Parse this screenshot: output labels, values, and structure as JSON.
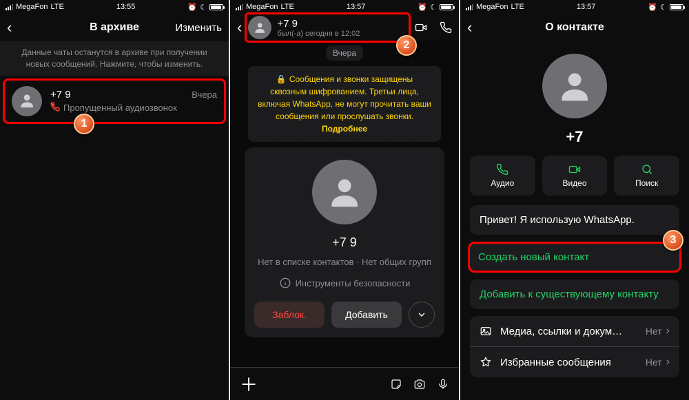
{
  "status": {
    "carrier": "MegaFon",
    "net": "LTE",
    "t1": "13:55",
    "t2": "13:57",
    "t3": "13:57"
  },
  "s1": {
    "title": "В архиве",
    "edit": "Изменить",
    "banner": "Данные чаты останутся в архиве при получении новых сообщений. Нажмите, чтобы изменить.",
    "chat": {
      "name": "+7 9",
      "date": "Вчера",
      "sub": "Пропущенный аудиозвонок"
    }
  },
  "s2": {
    "name": "+7 9",
    "seen": "был(-а) сегодня в 12:02",
    "day": "Вчера",
    "enc_pre": "Сообщения и звонки защищены сквозным шифрованием. Третьи лица, включая WhatsApp, не могут прочитать ваши сообщения или прослушать звонки.",
    "enc_more": "Подробнее",
    "card_name": "+7 9",
    "card_sub": "Нет в списке контактов · Нет общих групп",
    "tools": "Инструменты безопасности",
    "block": "Заблок.",
    "add": "Добавить"
  },
  "s3": {
    "title": "О контакте",
    "name": "+7",
    "audio": "Аудио",
    "video": "Видео",
    "search": "Поиск",
    "about": "Привет! Я использую WhatsApp.",
    "create": "Создать новый контакт",
    "existing": "Добавить к существующему контакту",
    "media": "Медиа, ссылки и докум…",
    "starred": "Избранные сообщения",
    "none": "Нет"
  },
  "steps": {
    "a": "1",
    "b": "2",
    "c": "3"
  }
}
